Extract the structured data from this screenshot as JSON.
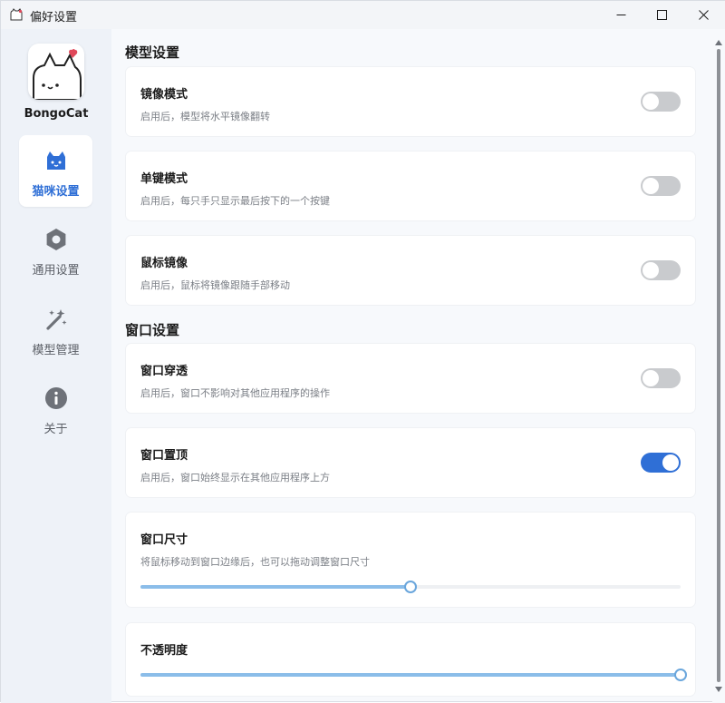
{
  "window": {
    "title": "偏好设置",
    "controls": {
      "minimize": "minimize-icon",
      "maximize": "maximize-icon",
      "close": "close-icon"
    }
  },
  "sidebar": {
    "app_name": "BongoCat",
    "items": [
      {
        "label": "猫咪设置",
        "icon": "cat-icon",
        "active": true
      },
      {
        "label": "通用设置",
        "icon": "gear-icon",
        "active": false
      },
      {
        "label": "模型管理",
        "icon": "magic-wand-icon",
        "active": false
      },
      {
        "label": "关于",
        "icon": "info-icon",
        "active": false
      }
    ]
  },
  "sections": {
    "model": {
      "title": "模型设置",
      "cards": [
        {
          "title": "镜像模式",
          "desc": "启用后，模型将水平镜像翻转",
          "enabled": false
        },
        {
          "title": "单键模式",
          "desc": "启用后，每只手只显示最后按下的一个按键",
          "enabled": false
        },
        {
          "title": "鼠标镜像",
          "desc": "启用后，鼠标将镜像跟随手部移动",
          "enabled": false
        }
      ]
    },
    "window": {
      "title": "窗口设置",
      "cards": [
        {
          "title": "窗口穿透",
          "desc": "启用后，窗口不影响对其他应用程序的操作",
          "enabled": false
        },
        {
          "title": "窗口置顶",
          "desc": "启用后，窗口始终显示在其他应用程序上方",
          "enabled": true
        }
      ],
      "size": {
        "title": "窗口尺寸",
        "desc": "将鼠标移动到窗口边缘后，也可以拖动调整窗口尺寸",
        "value_percent": 50
      },
      "opacity": {
        "title": "不透明度",
        "value_percent": 100
      }
    }
  },
  "colors": {
    "accent": "#2f6fd6",
    "slider_fill": "#8bbde9",
    "toggle_off": "#c9cbce"
  }
}
